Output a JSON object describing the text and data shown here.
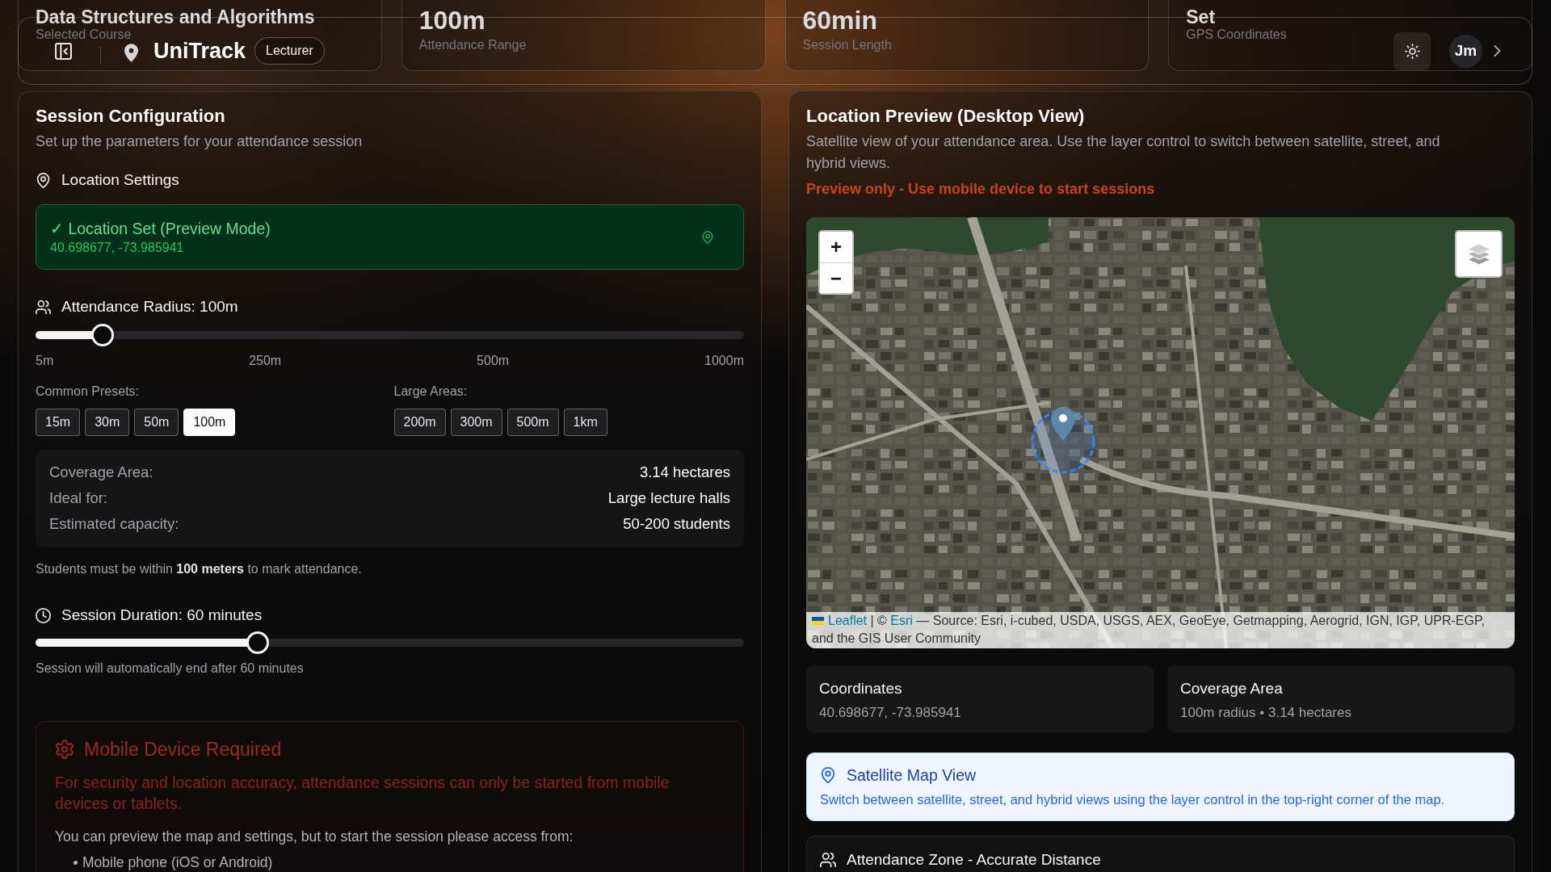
{
  "stats": [
    {
      "kind": "text",
      "value": "Data Structures and Algorithms",
      "label": "Selected Course"
    },
    {
      "kind": "metric",
      "value": "100m",
      "label": "Attendance Range"
    },
    {
      "kind": "metric",
      "value": "60min",
      "label": "Session Length"
    },
    {
      "kind": "text",
      "value": "Set",
      "label": "GPS Coordinates"
    }
  ],
  "header": {
    "app_name": "UniTrack",
    "role": "Lecturer",
    "avatar_initials": "Jm"
  },
  "session_config": {
    "title": "Session Configuration",
    "subtitle": "Set up the parameters for your attendance session",
    "location": {
      "heading": "Location Settings",
      "status": "✓ Location Set (Preview Mode)",
      "coordinates": "40.698677, -73.985941"
    },
    "radius": {
      "heading": "Attendance Radius: 100m",
      "level": 0.095,
      "ticks": [
        "5m",
        "250m",
        "500m",
        "1000m"
      ],
      "preset_groups": [
        {
          "label": "Common Presets:",
          "presets": [
            {
              "label": "15m",
              "selected": false
            },
            {
              "label": "30m",
              "selected": false
            },
            {
              "label": "50m",
              "selected": false
            },
            {
              "label": "100m",
              "selected": true
            }
          ]
        },
        {
          "label": "Large Areas:",
          "presets": [
            {
              "label": "200m",
              "selected": false
            },
            {
              "label": "300m",
              "selected": false
            },
            {
              "label": "500m",
              "selected": false
            },
            {
              "label": "1km",
              "selected": false
            }
          ]
        }
      ],
      "details": [
        {
          "label": "Coverage Area:",
          "value": "3.14 hectares"
        },
        {
          "label": "Ideal for:",
          "value": "Large lecture halls"
        },
        {
          "label": "Estimated capacity:",
          "value": "50-200 students"
        }
      ],
      "note": "Students must be within **100 meters** to mark attendance."
    },
    "duration": {
      "heading": "Session Duration: 60 minutes",
      "level": 0.314,
      "note": "Session will automatically end after 60 minutes"
    },
    "warning": {
      "title": "Mobile Device Required",
      "message": "For security and location accuracy, attendance sessions can only be started from mobile devices or tablets.",
      "instruction": "You can preview the map and settings, but to start the session please access from:",
      "options": [
        "Mobile phone (iOS or Android)"
      ]
    }
  },
  "location_preview": {
    "title": "Location Preview (Desktop View)",
    "description": "Satellite view of your attendance area. Use the layer control to switch between satellite, street, and hybrid views.",
    "notice": "Preview only - Use mobile device to start sessions",
    "map": {
      "zoom_controls": [
        "+",
        "−"
      ],
      "attribution": [
        {
          "kind": "link",
          "text": "Leaflet"
        },
        {
          "kind": "text",
          "text": " | © "
        },
        {
          "kind": "link",
          "text": "Esri"
        },
        {
          "kind": "text",
          "text": " — Source: Esri, i-cubed, USDA, USGS, AEX, GeoEye, Getmapping, Aerogrid, IGN, IGP, UPR-EGP, and the GIS User Community"
        }
      ]
    },
    "info_cards": [
      {
        "title": "Coordinates",
        "value": "40.698677, -73.985941"
      },
      {
        "title": "Coverage Area",
        "value": "100m radius • 3.14 hectares"
      }
    ],
    "tip": {
      "title": "Satellite Map View",
      "text": "Switch between satellite, street, and hybrid views using the layer control in the top-right corner of the map."
    },
    "zone": {
      "title": "Attendance Zone - Accurate Distance"
    }
  }
}
